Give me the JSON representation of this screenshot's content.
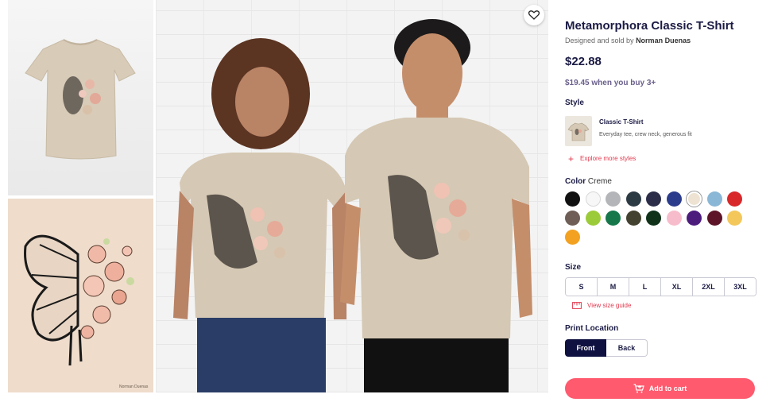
{
  "product": {
    "title": "Metamorphora Classic T-Shirt",
    "byline_prefix": "Designed and sold by ",
    "artist": "Norman Duenas",
    "price": "$22.88",
    "bulk_price": "$19.45 when you buy 3+"
  },
  "gallery": {
    "artwork_signature": "Norman Duenas"
  },
  "style": {
    "label": "Style",
    "name": "Classic T-Shirt",
    "description": "Everyday tee, crew neck, generous fit",
    "explore_label": "Explore more styles"
  },
  "color": {
    "label": "Color",
    "selected": "Creme",
    "swatches": [
      {
        "name": "black",
        "hex": "#111111"
      },
      {
        "name": "white",
        "hex": "#f7f7f7"
      },
      {
        "name": "heather-grey",
        "hex": "#b4b5b9"
      },
      {
        "name": "dark-slate",
        "hex": "#2c3a44"
      },
      {
        "name": "navy",
        "hex": "#2b2d49"
      },
      {
        "name": "royal-blue",
        "hex": "#2c3c8c"
      },
      {
        "name": "creme",
        "hex": "#eee3d2"
      },
      {
        "name": "light-blue",
        "hex": "#8ab7d6"
      },
      {
        "name": "red",
        "hex": "#d8282a"
      },
      {
        "name": "brown",
        "hex": "#6e5e55"
      },
      {
        "name": "lime",
        "hex": "#9ccb3a"
      },
      {
        "name": "kelly-green",
        "hex": "#15774a"
      },
      {
        "name": "olive",
        "hex": "#43412f"
      },
      {
        "name": "forest",
        "hex": "#0f3219"
      },
      {
        "name": "light-pink",
        "hex": "#f7bccc"
      },
      {
        "name": "purple",
        "hex": "#4c1c7d"
      },
      {
        "name": "maroon",
        "hex": "#5d1428"
      },
      {
        "name": "yellow",
        "hex": "#f3c75a"
      },
      {
        "name": "orange",
        "hex": "#f2a121"
      }
    ]
  },
  "size": {
    "label": "Size",
    "options": [
      "S",
      "M",
      "L",
      "XL",
      "2XL",
      "3XL"
    ],
    "guide_label": "View size guide"
  },
  "print_location": {
    "label": "Print Location",
    "options": [
      "Front",
      "Back"
    ],
    "selected": "Front"
  },
  "cart": {
    "label": "Add to cart"
  },
  "colors": {
    "accent": "#ff5a6e",
    "primary": "#0f1140"
  }
}
